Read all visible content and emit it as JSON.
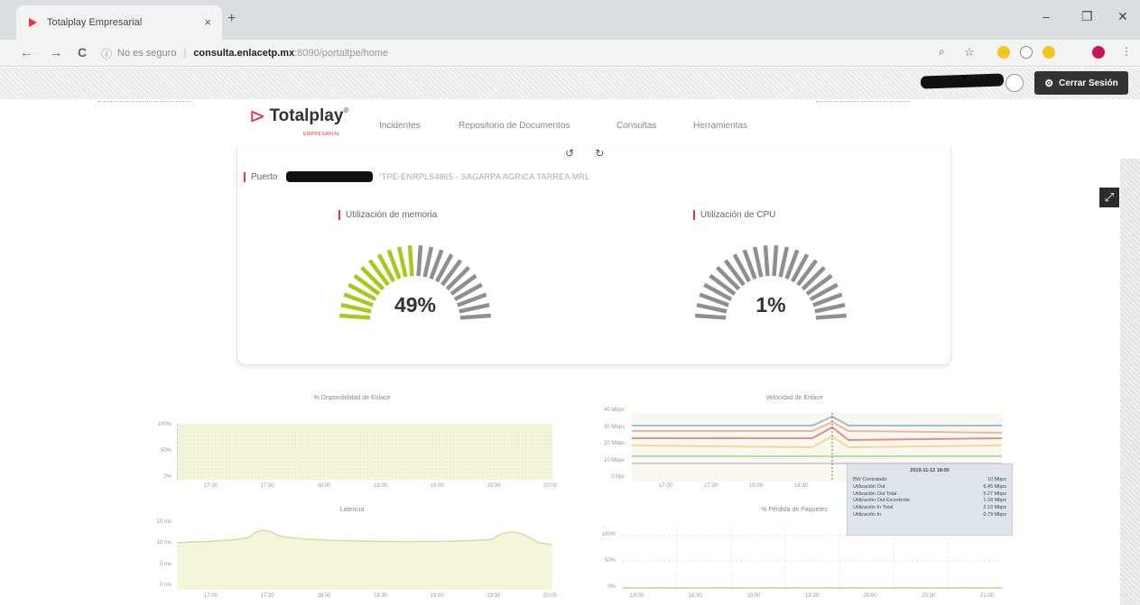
{
  "browser": {
    "tab_title": "Totalplay Empresarial",
    "tab_close": "×",
    "new_tab": "+",
    "nav": {
      "back": "←",
      "forward": "→",
      "reload": "C"
    },
    "address": {
      "insecure_label": "No es seguro",
      "separator": "|",
      "host": "consulta.enlacetp.mx",
      "path": ":8090/portaltpe/home"
    },
    "window_controls": {
      "minimize": "–",
      "restore": "❐",
      "close": "✕"
    }
  },
  "header": {
    "logout_label": "Cerrar Sesión"
  },
  "site_nav": {
    "brand": "Totalplay",
    "brand_mark": "⊳",
    "brand_reg": "®",
    "brand_sub": "EMPRESARIAL",
    "links": [
      "Incidentes",
      "Repositorio de Documentos",
      "Consultas",
      "Herramientas"
    ]
  },
  "card": {
    "refresh_icons": "↺ ↻",
    "port_label": "Puerto",
    "port_description": "\"TPE-ENRPLS4865 - SAGARPA AGRICA TARREA MRL",
    "memory": {
      "title": "Utilización de memoria",
      "value_label": "49%",
      "percent": 49
    },
    "cpu": {
      "title": "Utilización de CPU",
      "value_label": "1%",
      "percent": 1
    }
  },
  "charts": {
    "availability": {
      "title": "% Disponibilidad de Enlace",
      "yticks": [
        "100%",
        "50%",
        "0%"
      ],
      "xticks": [
        "17:00",
        "17:30",
        "18:00",
        "18:30",
        "19:00",
        "19:30",
        "20:00"
      ]
    },
    "bandwidth": {
      "title": "Velocidad de Enlace",
      "yticks": [
        "40 Mbps",
        "30 Mbps",
        "20 Mbps",
        "10 Mbps",
        "0 bps"
      ],
      "xticks": [
        "17:00",
        "17:30",
        "18:00",
        "18:30"
      ],
      "tooltip": {
        "title": "2019-11-12 18:00",
        "rows": [
          {
            "label": "BW Contratado",
            "value": "10 Mbps"
          },
          {
            "label": "Utilización Out",
            "value": "6.45 Mbps"
          },
          {
            "label": "Utilización Out Total",
            "value": "5.27 Mbps"
          },
          {
            "label": "Utilización Out Excedente",
            "value": "1.18 Mbps"
          },
          {
            "label": "Utilización In Total",
            "value": "2.10 Mbps"
          },
          {
            "label": "Utilización In",
            "value": "0.79 Mbps"
          }
        ]
      }
    },
    "latency": {
      "title": "Latencia",
      "yticks": [
        "15 ms",
        "10 ms",
        "5 ms",
        "0 ms"
      ],
      "xticks": [
        "17:00",
        "17:30",
        "18:00",
        "18:30",
        "19:00",
        "19:30",
        "20:00"
      ]
    },
    "packet_loss": {
      "title": "% Pérdida de Paquetes",
      "yticks": [
        "100%",
        "50%",
        "0%"
      ],
      "xticks": [
        "18:00",
        "18:30",
        "19:00",
        "19:30",
        "20:00",
        "20:30",
        "21:00"
      ]
    }
  },
  "colors": {
    "accent_red": "#e8323c",
    "gauge_green": "#a8c81c",
    "gauge_grey": "#8f8f8f",
    "plot_fill": "#f4f6dc"
  }
}
